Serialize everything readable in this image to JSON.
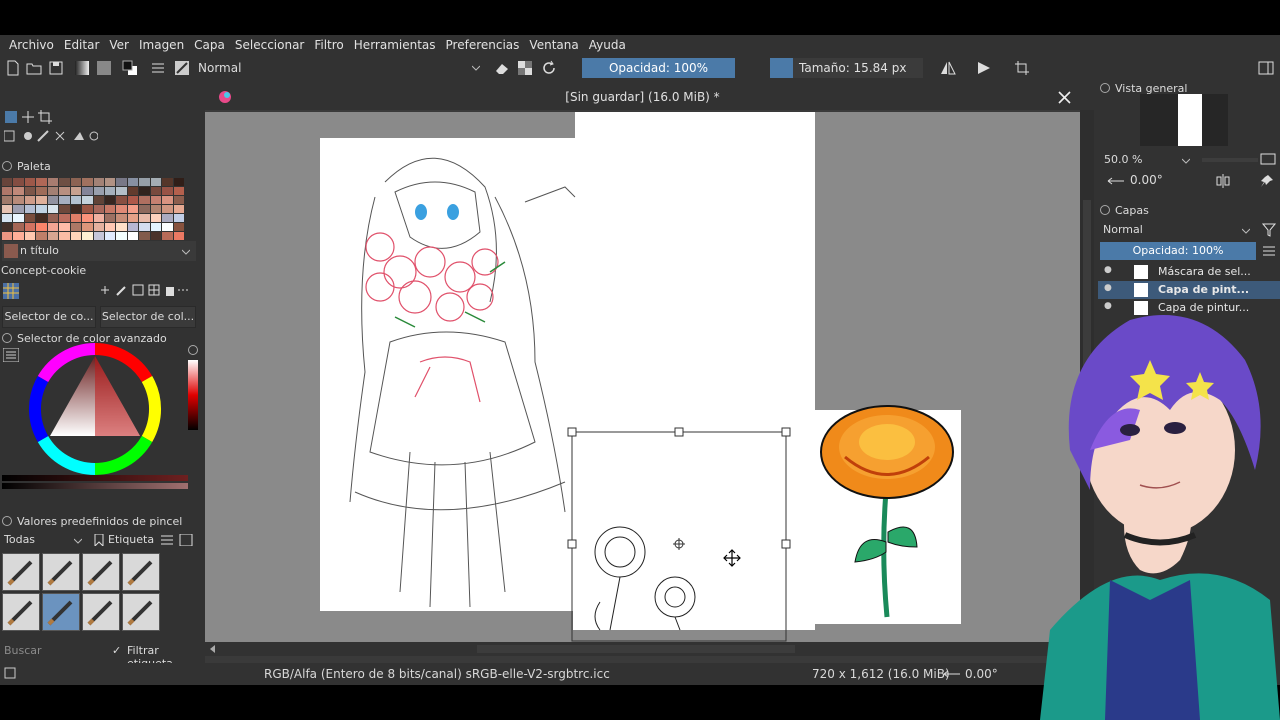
{
  "menu": [
    "Archivo",
    "Editar",
    "Ver",
    "Imagen",
    "Capa",
    "Seleccionar",
    "Filtro",
    "Herramientas",
    "Preferencias",
    "Ventana",
    "Ayuda"
  ],
  "toolbar": {
    "blend_mode": "Normal",
    "opacity": "Opacidad: 100%",
    "size": "Tamaño: 15.84 px",
    "size_fraction": 0.15
  },
  "left_dock": {
    "palette_title": "Paleta",
    "palette_name": "n título",
    "palette_set": "Concept-cookie",
    "tab_selector_1": "Selector de co...",
    "tab_selector_2": "Selector de col...",
    "adv_selector_title": "Selector de color avanzado",
    "brush_presets_title": "Valores predefinidos de pincel",
    "brush_filter": "Todas",
    "brush_tag_label": "Etiqueta",
    "search_placeholder": "Buscar",
    "filter_tag_label": "Filtrar etiqueta",
    "palette_colors": [
      "#8a5a4e",
      "#a8685c",
      "#c07a6a",
      "#d28f80",
      "#e0a596",
      "#8e6a5e",
      "#b08676",
      "#c69a8a",
      "#d9ae9e",
      "#e8c4b4",
      "#a0a0b0",
      "#b8c0d0",
      "#c8d4e0",
      "#dce6ee",
      "#6a4a3e",
      "#3a2a24"
    ]
  },
  "canvas": {
    "title": "[Sin guardar]  (16.0 MiB) *"
  },
  "right_dock": {
    "overview_title": "Vista general",
    "zoom": "50.0 %",
    "rotation": "0.00°",
    "layers_title": "Capas",
    "layers_blend": "Normal",
    "layers_opacity": "Opacidad:  100%",
    "layers": [
      {
        "name": "Máscara de sel...",
        "active": false
      },
      {
        "name": "Capa de pint...",
        "active": true
      },
      {
        "name": "Capa de pintur...",
        "active": false
      }
    ]
  },
  "status": {
    "color_space": "RGB/Alfa (Entero de 8 bits/canal)  sRGB-elle-V2-srgbtrc.icc",
    "dimensions": "720 x 1,612 (16.0 MiB)",
    "rotation": "0.00°"
  }
}
